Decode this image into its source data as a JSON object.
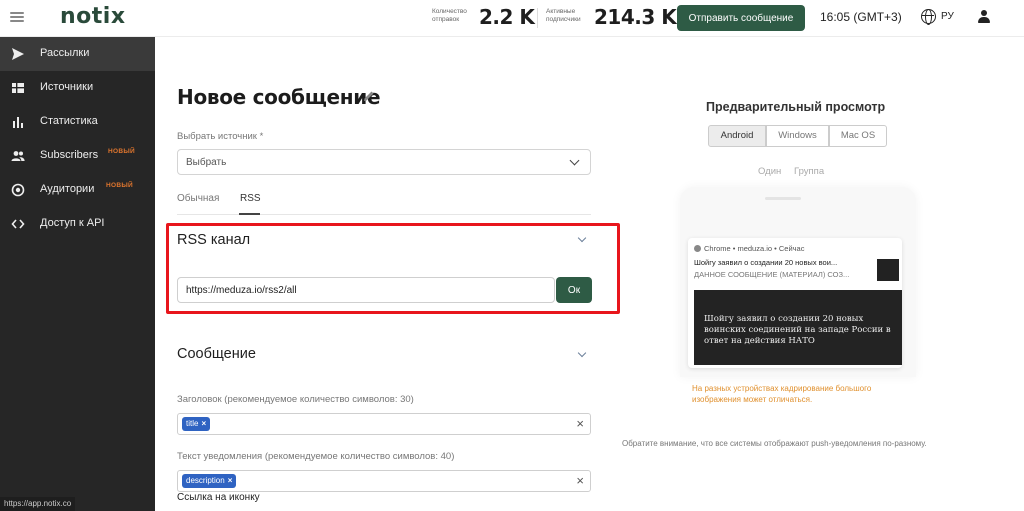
{
  "topbar": {
    "logo": "notix",
    "sent_label": "Количество отправок",
    "sent_value": "2.2 K",
    "subs_label": "Активные подписчики",
    "subs_value": "214.3 K",
    "send_button": "Отправить сообщение",
    "time": "16:05 (GMT+3)",
    "lang": "РУ"
  },
  "sidebar": {
    "items": [
      {
        "label": "Рассылки",
        "icon": "send-icon",
        "active": true
      },
      {
        "label": "Источники",
        "icon": "sources-icon"
      },
      {
        "label": "Статистика",
        "icon": "bar-chart-icon"
      },
      {
        "label": "Subscribers",
        "icon": "users-icon",
        "badge": "НОВЫЙ"
      },
      {
        "label": "Аудитории",
        "icon": "target-icon",
        "badge": "НОВЫЙ"
      },
      {
        "label": "Доступ к API",
        "icon": "code-icon"
      }
    ],
    "status_url": "https://app.notix.co"
  },
  "main": {
    "title": "Новое сообщение",
    "source_label": "Выбрать источник *",
    "source_value": "Выбрать",
    "tabs": [
      "Обычная",
      "RSS"
    ],
    "rss": {
      "title": "RSS канал",
      "url": "https://meduza.io/rss2/all",
      "ok": "Ок"
    },
    "message": {
      "title": "Сообщение",
      "header_label": "Заголовок (рекомендуемое количество символов: 30)",
      "header_tag": "title",
      "text_label": "Текст уведомления (рекомендуемое количество символов: 40)",
      "text_tag": "description",
      "icon_label": "Ссылка на иконку"
    }
  },
  "preview": {
    "title": "Предварительный просмотр",
    "os_tabs": [
      "Android",
      "Windows",
      "Mac OS"
    ],
    "sub_tabs": [
      "Один",
      "Группа"
    ],
    "notification": {
      "head": "Chrome • meduza.io • Сейчас",
      "title": "Шойгу заявил о создании 20 новых вои...",
      "body": "ДАННОЕ СООБЩЕНИЕ (МАТЕРИАЛ) СОЗ...",
      "image_text": "Шойгу заявил о создании 20 новых воинских соединений на западе России в ответ на действия НАТО"
    },
    "warning": "На разных устройствах кадрирование большого изображения может отличаться.",
    "note": "Обратите внимание, что все системы отображают push-уведомления по-разному."
  }
}
